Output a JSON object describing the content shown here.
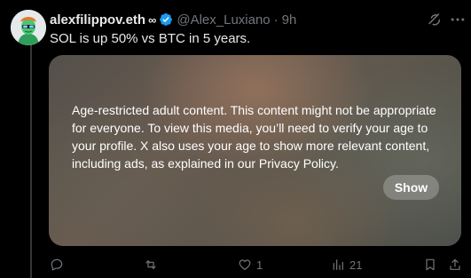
{
  "tweet": {
    "author_name": "alexfilippov.eth",
    "author_suffix": "∞",
    "handle": "@Alex_Luxiano",
    "separator": "·",
    "time": "9h",
    "text": "SOL is up 50% vs BTC in 5 years."
  },
  "media": {
    "warning": "Age-restricted adult content. This content might not be appropriate for everyone. To view this media, you’ll need to verify your age to your profile. X also uses your age to show more relevant content, including ads, as explained in our Privacy Policy.",
    "show_label": "Show"
  },
  "actions": {
    "reply_count": "",
    "repost_count": "",
    "like_count": "1",
    "views_count": "21"
  },
  "colors": {
    "background": "#000000",
    "primary_text": "#e7e9ea",
    "secondary_text": "#71767b",
    "verified_blue": "#1d9bf0"
  }
}
